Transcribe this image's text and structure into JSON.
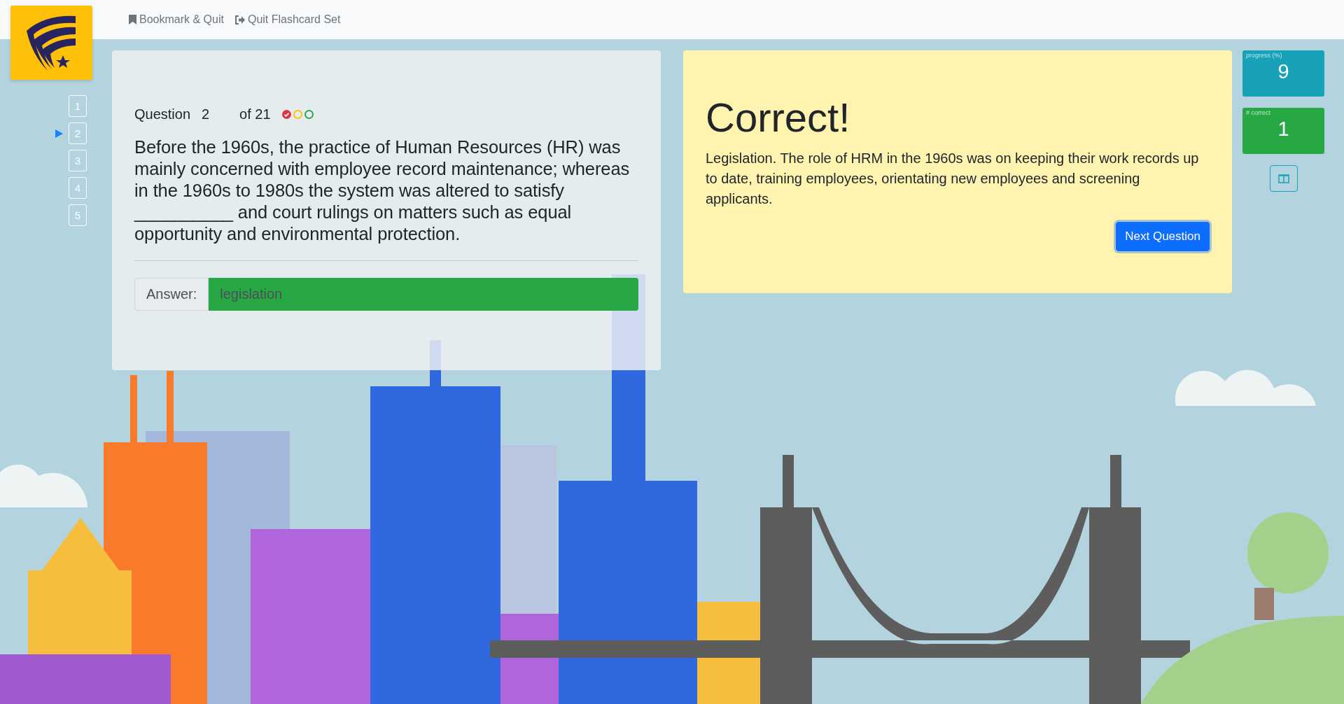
{
  "header": {
    "bookmark_quit": "Bookmark & Quit",
    "quit_set": "Quit Flashcard Set"
  },
  "question_nav": [
    {
      "label": "1",
      "selected": false
    },
    {
      "label": "2",
      "selected": true
    },
    {
      "label": "3",
      "selected": false
    },
    {
      "label": "4",
      "selected": false
    },
    {
      "label": "5",
      "selected": false
    }
  ],
  "question": {
    "label": "Question",
    "number": "2",
    "total": "of 21",
    "status_dots": [
      {
        "color": "#dc3545",
        "checked": true
      },
      {
        "color": "#ffc107",
        "checked": false
      },
      {
        "color": "#28a745",
        "checked": false
      }
    ],
    "text": "Before the 1960s, the practice of Human Resources (HR) was mainly concerned with employee record maintenance; whereas in the 1960s to 1980s the system was altered to satisfy __________ and court rulings on matters such as equal opportunity and environmental protection.",
    "answer_label": "Answer:",
    "answer": "legislation",
    "answer_correct": true
  },
  "feedback": {
    "title": "Correct!",
    "explanation": "Legislation. The role of HRM in the 1960s was on keeping their work records up to date, training employees, orientating new employees and screening applicants.",
    "button": "Next Question"
  },
  "stats": [
    {
      "label": "progress (%)",
      "value": "9",
      "color": "#17a2b8"
    },
    {
      "label": "# correct",
      "value": "1",
      "color": "#28a745"
    }
  ]
}
